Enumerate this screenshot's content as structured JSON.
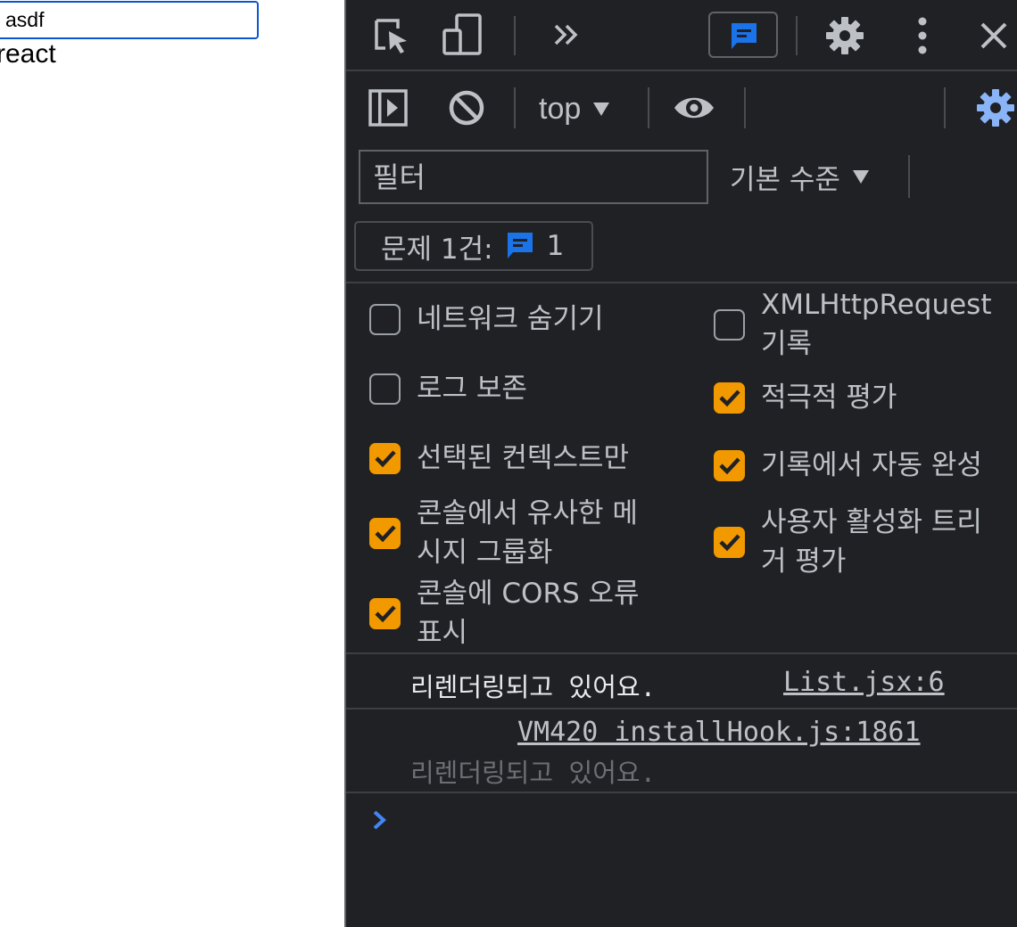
{
  "page": {
    "input_value": "asdf",
    "text": "react"
  },
  "devtools": {
    "context": "top",
    "filter": {
      "placeholder": "필터"
    },
    "level": "기본 수준",
    "issues": {
      "label": "문제 1건:",
      "count": "1"
    },
    "settings": {
      "hide_network": {
        "label": "네트워크 숨기기",
        "checked": false
      },
      "log_xhr": {
        "label_line1": "XMLHttpRequest",
        "label_line2": "기록",
        "checked": false
      },
      "preserve_log": {
        "label": "로그 보존",
        "checked": false
      },
      "eager_eval": {
        "label": "적극적 평가",
        "checked": true
      },
      "selected_context": {
        "label": "선택된 컨텍스트만",
        "checked": true
      },
      "autocomplete": {
        "label": "기록에서 자동 완성",
        "checked": true
      },
      "group_similar": {
        "label_line1": "콘솔에서 유사한 메",
        "label_line2": "시지 그룹화",
        "checked": true
      },
      "user_activation": {
        "label_line1": "사용자 활성화 트리",
        "label_line2": "거 평가",
        "checked": true
      },
      "cors_errors": {
        "label_line1": "콘솔에 CORS 오류",
        "label_line2": "표시",
        "checked": true
      }
    },
    "messages": [
      {
        "text": "리렌더링되고 있어요.",
        "source": "List.jsx:6"
      },
      {
        "source": "VM420 installHook.js:1861",
        "text": "리렌더링되고 있어요."
      }
    ],
    "colors": {
      "bg": "#202124",
      "accent": "#1a73e8",
      "checkbox": "#f29900",
      "text": "#bdc1c6"
    }
  }
}
